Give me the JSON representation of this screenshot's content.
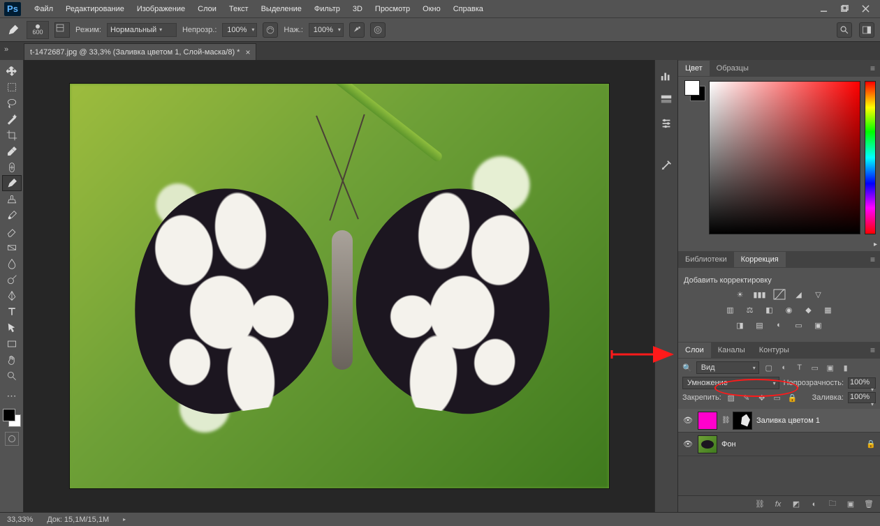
{
  "menu": {
    "items": [
      "Файл",
      "Редактирование",
      "Изображение",
      "Слои",
      "Текст",
      "Выделение",
      "Фильтр",
      "3D",
      "Просмотр",
      "Окно",
      "Справка"
    ]
  },
  "options": {
    "brush_size": "600",
    "mode_label": "Режим:",
    "mode_value": "Нормальный",
    "opacity_label": "Непрозр.:",
    "opacity_value": "100%",
    "flow_label": "Наж.:",
    "flow_value": "100%"
  },
  "document": {
    "tab_title": "t-1472687.jpg @ 33,3% (Заливка цветом 1, Слой-маска/8) *"
  },
  "panel_color": {
    "tab1": "Цвет",
    "tab2": "Образцы"
  },
  "panel_lib": {
    "tab1": "Библиотеки",
    "tab2": "Коррекция",
    "add_label": "Добавить корректировку"
  },
  "panel_layers": {
    "tab1": "Слои",
    "tab2": "Каналы",
    "tab3": "Контуры",
    "kind_label": "Вид",
    "blend_value": "Умножение",
    "opacity_label": "Непрозрачность:",
    "opacity_value": "100%",
    "lock_label": "Закрепить:",
    "fill_label": "Заливка:",
    "fill_value": "100%",
    "layers": [
      {
        "name": "Заливка цветом 1",
        "selected": true,
        "fill": "magenta",
        "has_mask": true
      },
      {
        "name": "Фон",
        "selected": false,
        "fill": "photo",
        "locked": true
      }
    ]
  },
  "status": {
    "zoom": "33,33%",
    "doc": "Док: 15,1M/15,1M"
  }
}
